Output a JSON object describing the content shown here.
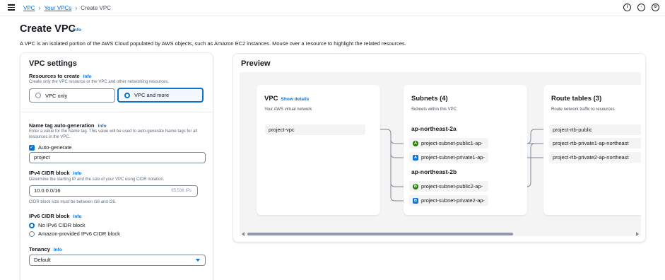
{
  "breadcrumb": {
    "items": [
      "VPC",
      "Your VPCs",
      "Create VPC"
    ]
  },
  "page": {
    "title": "Create VPC",
    "info": "Info",
    "description": "A VPC is an isolated portion of the AWS Cloud populated by AWS objects, such as Amazon EC2 instances. Mouse over a resource to highlight the related resources."
  },
  "settings": {
    "title": "VPC settings",
    "resources_label": "Resources to create",
    "resources_info": "Info",
    "resources_hint": "Create only the VPC resource or the VPC and other networking resources.",
    "option_vpc_only": "VPC only",
    "option_vpc_more": "VPC and more",
    "selected_option": "VPC and more",
    "name_tag_label": "Name tag auto-generation",
    "name_tag_info": "Info",
    "name_tag_hint": "Enter a value for the Name tag. This value will be used to auto-generate Name tags for all resources in the VPC.",
    "auto_generate_label": "Auto-generate",
    "auto_generate_checked": true,
    "name_tag_value": "project",
    "ipv4_label": "IPv4 CIDR block",
    "ipv4_info": "Info",
    "ipv4_hint": "Determine the starting IP and the size of your VPC using CIDR notation.",
    "ipv4_value": "10.0.0.0/16",
    "ipv4_ips": "65,536 IPs",
    "ipv4_constraint": "CIDR block size must be between /16 and /28.",
    "ipv6_label": "IPv6 CIDR block",
    "ipv6_info": "Info",
    "ipv6_option_none": "No IPv6 CIDR block",
    "ipv6_option_amazon": "Amazon-provided IPv6 CIDR block",
    "ipv6_selected": "No IPv6 CIDR block",
    "tenancy_label": "Tenancy",
    "tenancy_info": "Info",
    "tenancy_value": "Default"
  },
  "preview": {
    "title": "Preview",
    "vpc": {
      "title": "VPC",
      "show_details": "Show details",
      "subtitle": "Your AWS virtual network",
      "resource": "project-vpc"
    },
    "subnets": {
      "title": "Subnets (4)",
      "subtitle": "Subnets within this VPC",
      "az1": "ap-northeast-2a",
      "az2": "ap-northeast-2b",
      "items": [
        "project-subnet-public1-ap-",
        "project-subnet-private1-ap-",
        "project-subnet-public2-ap-",
        "project-subnet-private2-ap-"
      ]
    },
    "route_tables": {
      "title": "Route tables (3)",
      "subtitle": "Route network traffic to resources",
      "items": [
        "project-rtb-public",
        "project-rtb-private1-ap-northeast",
        "project-rtb-private2-ap-northeast"
      ]
    }
  },
  "colors": {
    "accent": "#0972d3",
    "public_subnet": "#1d8102",
    "private_subnet": "#0972d3"
  }
}
